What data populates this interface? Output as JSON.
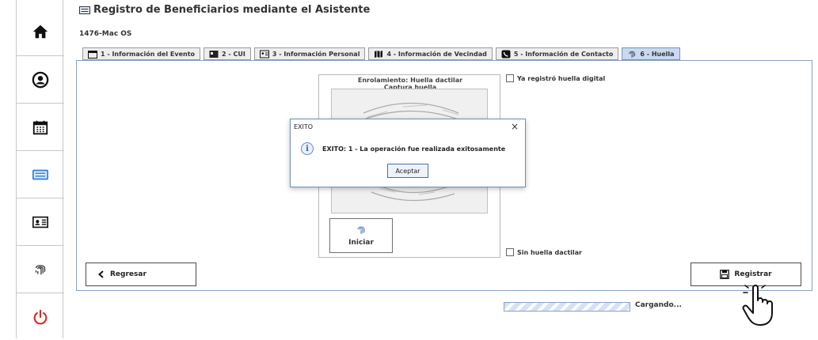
{
  "header": {
    "title": "Registro de Beneficiarios mediante el Asistente",
    "subtitle": "1476-Mac OS"
  },
  "sidebar": {
    "items": [
      {
        "icon": "home-icon"
      },
      {
        "icon": "user-icon"
      },
      {
        "icon": "calendar-icon"
      },
      {
        "icon": "keyboard-icon"
      },
      {
        "icon": "id-card-icon"
      },
      {
        "icon": "fingerprint-icon"
      },
      {
        "icon": "power-icon"
      }
    ]
  },
  "tabs": [
    {
      "label": "1 - Información del Evento",
      "icon": "calendar-icon"
    },
    {
      "label": "2 - CUI",
      "icon": "id-icon"
    },
    {
      "label": "3 - Información Personal",
      "icon": "id-card-icon"
    },
    {
      "label": "4 - Información de Vecindad",
      "icon": "map-icon"
    },
    {
      "label": "5 - Información de Contacto",
      "icon": "phone-icon"
    },
    {
      "label": "6 - Huella",
      "icon": "fingerprint-icon",
      "active": true
    }
  ],
  "fingerprint": {
    "title": "Enrolamiento: Huella dactilar",
    "capture_label": "Captura huella",
    "start_button": "Iniciar"
  },
  "checkboxes": {
    "already_registered": "Ya registró huella digital",
    "no_fingerprint": "Sin huella dactilar"
  },
  "buttons": {
    "back": "Regresar",
    "register": "Registrar"
  },
  "status": {
    "loading": "Cargando..."
  },
  "dialog": {
    "title": "EXITO",
    "close": "×",
    "icon_glyph": "i",
    "message": "EXITO: 1 - La operación fue realizada exitosamente",
    "ok_button": "Aceptar"
  },
  "colors": {
    "accent": "#c9d9ef",
    "power": "#d9302c",
    "panel_border": "#8aa0c4"
  }
}
